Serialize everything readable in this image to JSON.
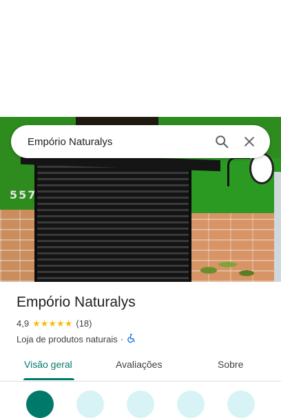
{
  "search": {
    "value": "Empório Naturalys",
    "search_icon": "search-icon",
    "close_icon": "close-icon"
  },
  "photo": {
    "house_number": "557"
  },
  "place": {
    "name": "Empório Naturalys",
    "rating": "4,9",
    "rating_value": 4.9,
    "stars_filled": 5,
    "review_count": "(18)",
    "category": "Loja de produtos naturais",
    "separator": "·",
    "accessibility_icon": "wheelchair-icon"
  },
  "tabs": [
    {
      "label": "Visão geral",
      "active": true
    },
    {
      "label": "Avaliações",
      "active": false
    },
    {
      "label": "Sobre",
      "active": false
    }
  ],
  "colors": {
    "accent": "#00796b",
    "star": "#fbbc04",
    "action_bg": "#d8f3f6",
    "accessibility": "#1a73e8"
  }
}
